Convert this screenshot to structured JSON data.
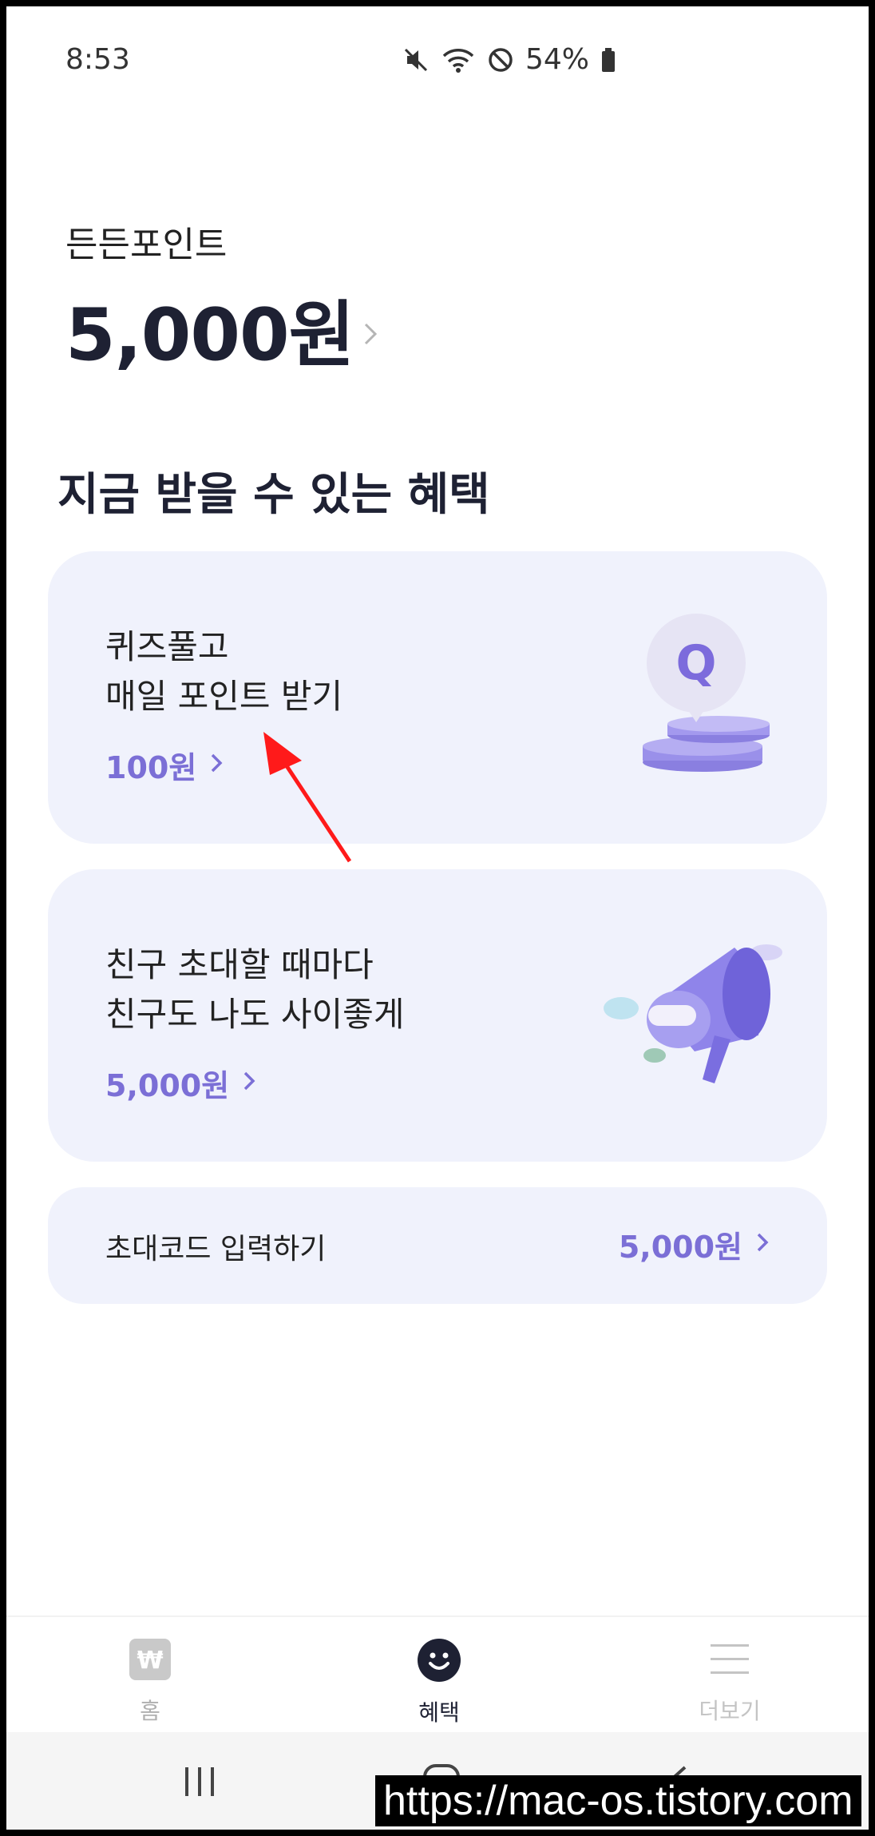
{
  "status_bar": {
    "time": "8:53",
    "battery": "54%"
  },
  "points": {
    "label": "든든포인트",
    "value": "5,000원"
  },
  "section_title": "지금 받을 수 있는 혜택",
  "cards": {
    "quiz": {
      "line1": "퀴즈풀고",
      "line2": "매일 포인트 받기",
      "reward": "100원"
    },
    "invite": {
      "line1": "친구 초대할 때마다",
      "line2": "친구도 나도 사이좋게",
      "reward": "5,000원"
    },
    "code": {
      "label": "초대코드 입력하기",
      "reward": "5,000원"
    }
  },
  "bottom_nav": {
    "home": "홈",
    "benefit": "혜택",
    "more": "더보기"
  },
  "watermark": "https://mac-os.tistory.com",
  "colors": {
    "accent": "#7b6fd6",
    "card_bg": "#f0f2fc",
    "dark": "#1e2133",
    "arrow": "#ff1a1a"
  }
}
